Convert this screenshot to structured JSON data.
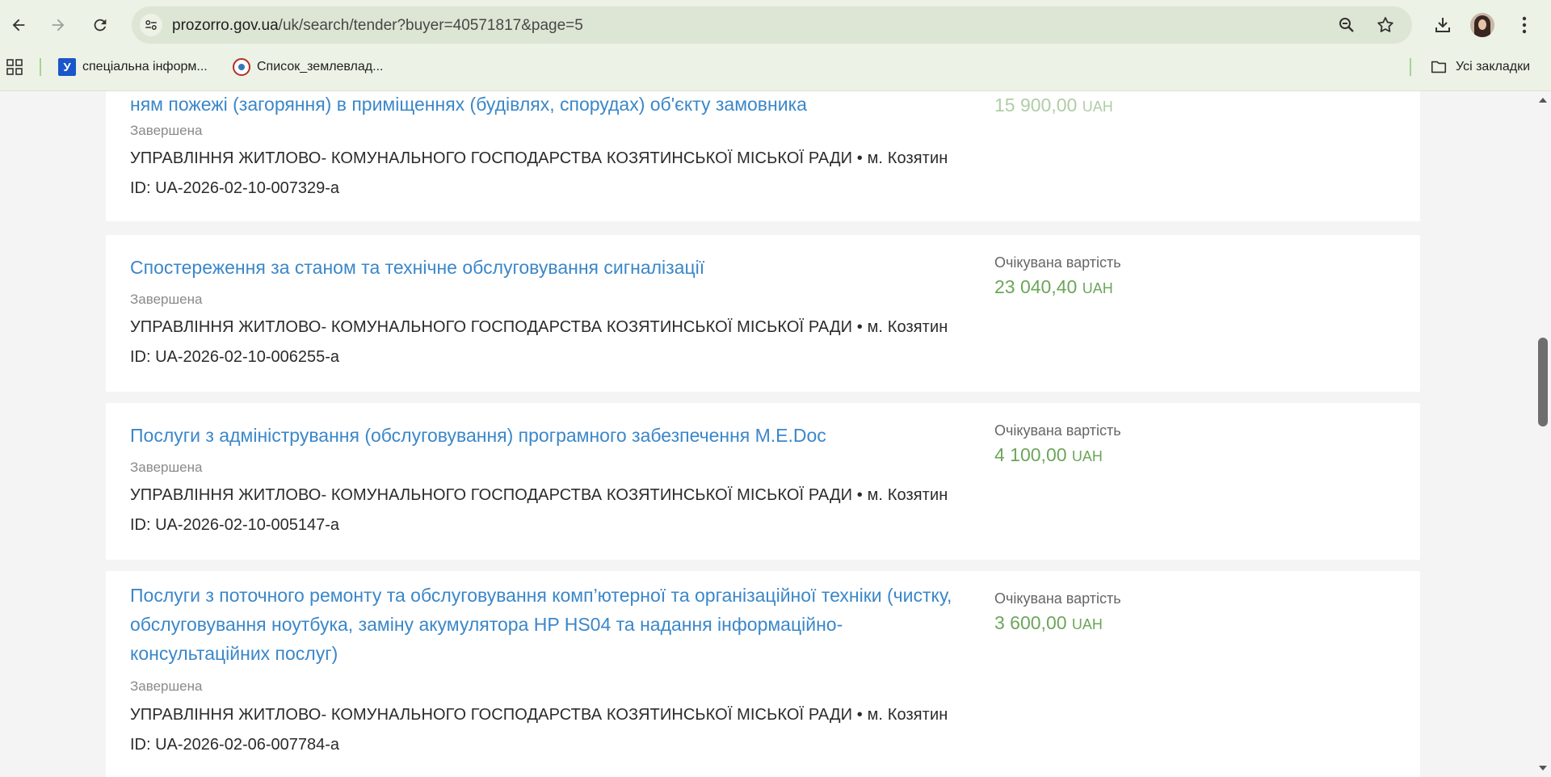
{
  "browser": {
    "url_host": "prozorro.gov.ua",
    "url_path": "/uk/search/tender?buyer=40571817&page=5",
    "bookmarks": [
      {
        "label": "спеціальна інформ...",
        "icon": "u-favicon"
      },
      {
        "label": "Список_землевлад...",
        "icon": "wikimedia-favicon"
      }
    ],
    "all_bookmarks_label": "Усі закладки"
  },
  "tenders": [
    {
      "title": "ням пожежі (загоряння) в приміщеннях (будівлях, спорудах) об'єкту замовника",
      "status": "Завершена",
      "buyer": "УПРАВЛІННЯ ЖИТЛОВО- КОМУНАЛЬНОГО ГОСПОДАРСТВА КОЗЯТИНСЬКОЇ МІСЬКОЇ РАДИ • м. Козятин",
      "id": "ID: UA-2026-02-10-007329-a",
      "price_label": "",
      "price": "15 900,00",
      "currency": "UAH"
    },
    {
      "title": "Спостереження за станом та технічне обслуговування сигналізації",
      "status": "Завершена",
      "buyer": "УПРАВЛІННЯ ЖИТЛОВО- КОМУНАЛЬНОГО ГОСПОДАРСТВА КОЗЯТИНСЬКОЇ МІСЬКОЇ РАДИ • м. Козятин",
      "id": "ID: UA-2026-02-10-006255-a",
      "price_label": "Очікувана вартість",
      "price": "23 040,40",
      "currency": "UAH"
    },
    {
      "title": "Послуги з адміністрування (обслуговування) програмного забезпечення M.E.Doc",
      "status": "Завершена",
      "buyer": "УПРАВЛІННЯ ЖИТЛОВО- КОМУНАЛЬНОГО ГОСПОДАРСТВА КОЗЯТИНСЬКОЇ МІСЬКОЇ РАДИ • м. Козятин",
      "id": "ID: UA-2026-02-10-005147-a",
      "price_label": "Очікувана вартість",
      "price": "4 100,00",
      "currency": "UAH"
    },
    {
      "title": "Послуги з поточного ремонту та обслуговування комп’ютерної та організаційної техніки (чистку, обслуговування ноутбука, заміну акумулятора HP HS04 та надання інформаційно-консультаційних послуг)",
      "status": "Завершена",
      "buyer": "УПРАВЛІННЯ ЖИТЛОВО- КОМУНАЛЬНОГО ГОСПОДАРСТВА КОЗЯТИНСЬКОЇ МІСЬКОЇ РАДИ • м. Козятин",
      "id": "ID: UA-2026-02-06-007784-a",
      "price_label": "Очікувана вартість",
      "price": "3 600,00",
      "currency": "UAH"
    }
  ],
  "colors": {
    "link": "#3b87c9",
    "price": "#6ca65a",
    "chrome": "#ecf2e6"
  }
}
